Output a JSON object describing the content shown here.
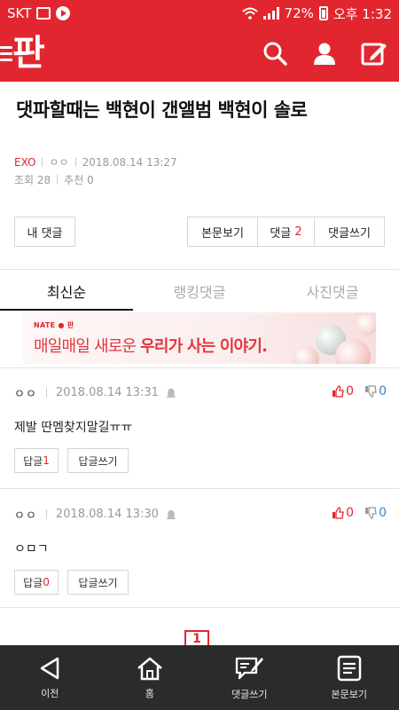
{
  "status_bar": {
    "carrier": "SKT",
    "battery": "72%",
    "time": "오후 1:32",
    "icons": [
      "gallery-icon",
      "play-icon",
      "wifi-icon",
      "signal-icon",
      "battery-icon"
    ]
  },
  "header": {
    "logo": "판",
    "icons": [
      "menu-icon",
      "search-icon",
      "user-icon",
      "write-icon"
    ],
    "brand_color": "#e2262f"
  },
  "article": {
    "title": "댓파할때는 백현이 갠앨범 백현이 솔로",
    "category": "EXO",
    "author": "ㅇㅇ",
    "datetime": "2018.08.14 13:27",
    "views": "조회 28",
    "recommend": "추천 0"
  },
  "actions": {
    "my_comments": "내 댓글",
    "view_article": "본문보기",
    "comments_label": "댓글",
    "comments_count": "2",
    "write_comment": "댓글쓰기"
  },
  "tabs": [
    {
      "label": "최신순",
      "active": true
    },
    {
      "label": "랭킹댓글",
      "active": false
    },
    {
      "label": "사진댓글",
      "active": false
    }
  ],
  "banner": {
    "brand": "NATE ● 판",
    "text_plain": "매일매일 새로운",
    "text_bold": "우리가 사는 이야기."
  },
  "comments": [
    {
      "author": "ㅇㅇ",
      "datetime": "2018.08.14 13:31",
      "text": "제발 딴멤찾지말길ㅠㅠ",
      "likes": "0",
      "dislikes": "0",
      "reply_label": "답글",
      "reply_count": "1",
      "write_reply": "답글쓰기"
    },
    {
      "author": "ㅇㅇ",
      "datetime": "2018.08.14 13:30",
      "text": "ㅇㅁㄱ",
      "likes": "0",
      "dislikes": "0",
      "reply_label": "답글",
      "reply_count": "0",
      "write_reply": "답글쓰기"
    }
  ],
  "pagination": {
    "current": "1"
  },
  "bottom_nav": [
    {
      "label": "이전",
      "icon": "back-icon"
    },
    {
      "label": "홈",
      "icon": "home-icon"
    },
    {
      "label": "댓글쓰기",
      "icon": "comment-write-icon"
    },
    {
      "label": "본문보기",
      "icon": "article-icon"
    }
  ]
}
